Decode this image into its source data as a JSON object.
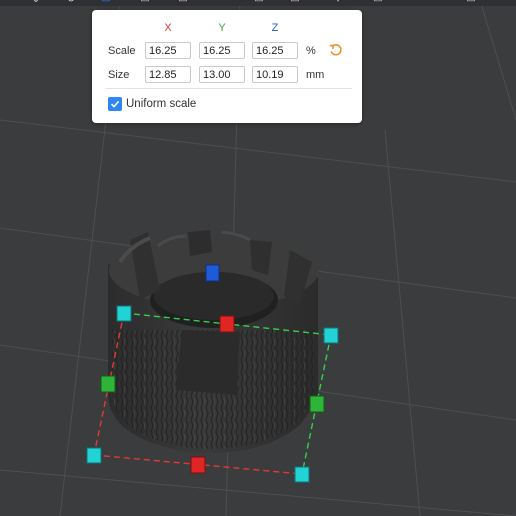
{
  "panel": {
    "axes": {
      "x": "X",
      "y": "Y",
      "z": "Z"
    },
    "scale": {
      "label": "Scale",
      "x": "16.25",
      "y": "16.25",
      "z": "16.25",
      "unit": "%"
    },
    "size": {
      "label": "Size",
      "x": "12.85",
      "y": "13.00",
      "z": "10.19",
      "unit": "mm"
    },
    "uniform_scale": {
      "label": "Uniform scale",
      "checked": true
    },
    "reset_icon": "undo-arrow-icon"
  },
  "colors": {
    "background": "#3b3c3e",
    "axis_x": "#e53935",
    "axis_y": "#43a047",
    "axis_z": "#1e5bd6",
    "corner_handle": "#22d3d6",
    "accent": "#2f86f6",
    "reset_icon": "#f0922e"
  }
}
